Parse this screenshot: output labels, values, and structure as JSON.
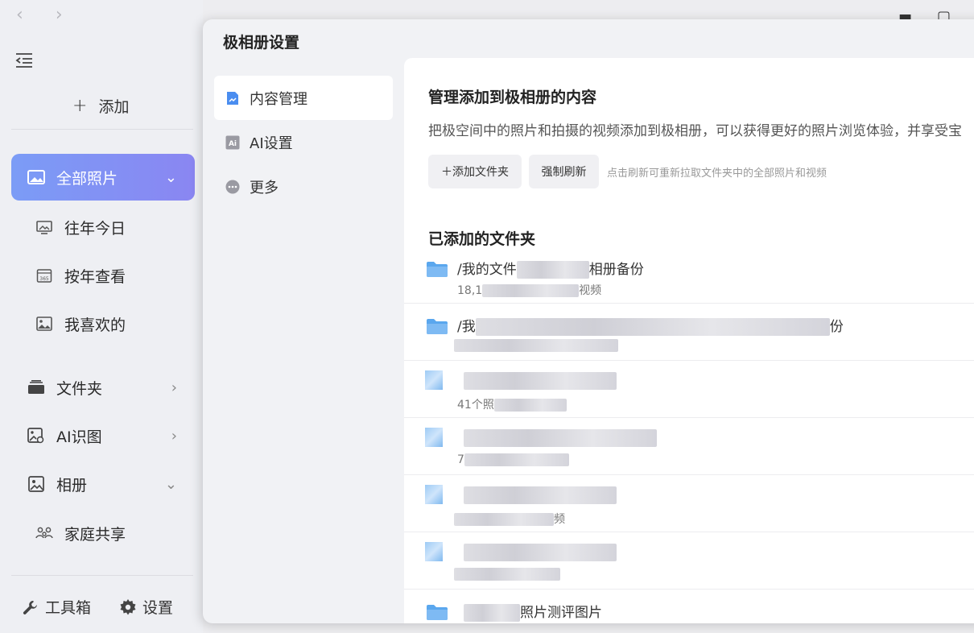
{
  "sidebar": {
    "add_label": "添加",
    "nav": [
      {
        "label": "全部照片",
        "icon": "photo-icon",
        "active": true
      },
      {
        "label": "往年今日",
        "icon": "monitor-photo-icon"
      },
      {
        "label": "按年查看",
        "icon": "calendar-365-icon"
      },
      {
        "label": "我喜欢的",
        "icon": "image-icon"
      },
      {
        "label": "文件夹",
        "icon": "folder-stack-icon"
      },
      {
        "label": "AI识图",
        "icon": "ai-image-icon"
      },
      {
        "label": "相册",
        "icon": "album-icon"
      },
      {
        "label": "家庭共享",
        "icon": "family-icon"
      }
    ],
    "tools": {
      "toolbox": "工具箱",
      "settings": "设置"
    }
  },
  "dialog": {
    "title": "极相册设置",
    "menu": [
      {
        "label": "内容管理",
        "icon": "content-manage-icon",
        "active": true
      },
      {
        "label": "AI设置",
        "icon": "ai-icon"
      },
      {
        "label": "更多",
        "icon": "more-icon"
      }
    ],
    "content": {
      "title": "管理添加到极相册的内容",
      "description": "把极空间中的照片和拍摄的视频添加到极相册，可以获得更好的照片浏览体验，并享受宝",
      "add_folder_button": "＋添加文件夹",
      "refresh_button": "强制刷新",
      "refresh_hint": "点击刷新可重新拉取文件夹中的全部照片和视频",
      "folders_title": "已添加的文件夹",
      "folders": [
        {
          "name_start": "/我的文件",
          "name_end": "相册备份",
          "meta_start": "18,1",
          "meta_end": "视频"
        },
        {
          "name_start": "/我",
          "name_end": "份",
          "meta_start": "",
          "meta_end": ""
        },
        {
          "name_start": "",
          "name_end": "",
          "meta_start": "41个照",
          "meta_end": ""
        },
        {
          "name_start": "",
          "name_end": "",
          "meta_start": "7",
          "meta_end": ""
        },
        {
          "name_start": "",
          "name_end": "",
          "meta_start": "",
          "meta_end": "频"
        },
        {
          "name_start": "",
          "name_end": "",
          "meta_start": "",
          "meta_end": ""
        },
        {
          "name_start": "",
          "name_end": "照片测评图片",
          "meta_start": "",
          "meta_end": ""
        }
      ]
    }
  }
}
